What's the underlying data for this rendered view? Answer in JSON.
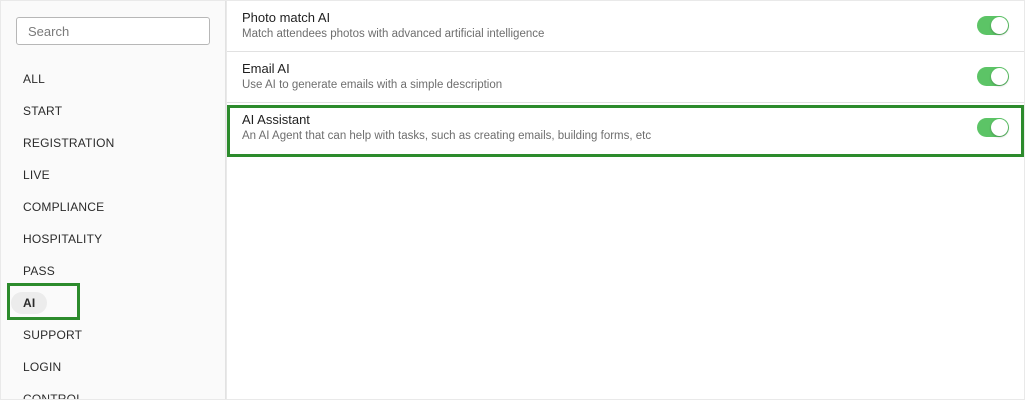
{
  "search": {
    "placeholder": "Search",
    "value": ""
  },
  "categories": [
    {
      "label": "ALL",
      "active": false
    },
    {
      "label": "START",
      "active": false
    },
    {
      "label": "REGISTRATION",
      "active": false
    },
    {
      "label": "LIVE",
      "active": false
    },
    {
      "label": "COMPLIANCE",
      "active": false
    },
    {
      "label": "HOSPITALITY",
      "active": false
    },
    {
      "label": "PASS",
      "active": false
    },
    {
      "label": "AI",
      "active": true
    },
    {
      "label": "SUPPORT",
      "active": false
    },
    {
      "label": "LOGIN",
      "active": false
    },
    {
      "label": "CONTROL",
      "active": false
    }
  ],
  "features": [
    {
      "title": "Photo match AI",
      "description": "Match attendees photos with advanced artificial intelligence",
      "enabled": true
    },
    {
      "title": "Email AI",
      "description": "Use AI to generate emails with a simple description",
      "enabled": true
    },
    {
      "title": "AI Assistant",
      "description": "An AI Agent that can help with tasks, such as creating emails, building forms, etc",
      "enabled": true
    }
  ],
  "colors": {
    "accent": "#2c8b2c",
    "toggle_on": "#5cc466"
  }
}
